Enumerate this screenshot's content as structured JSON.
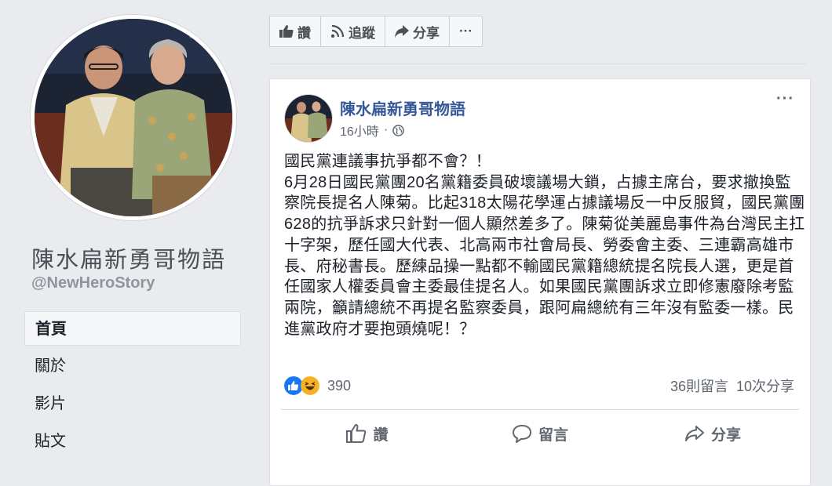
{
  "page": {
    "name": "陳水扁新勇哥物語",
    "handle": "@NewHeroStory"
  },
  "nav": {
    "items": [
      {
        "label": "首頁"
      },
      {
        "label": "關於"
      },
      {
        "label": "影片"
      },
      {
        "label": "貼文"
      }
    ]
  },
  "action_bar": {
    "like_label": "讚",
    "follow_label": "追蹤",
    "share_label": "分享",
    "more_label": "···"
  },
  "post": {
    "author": "陳水扁新勇哥物語",
    "time": "16小時",
    "separator": "·",
    "more_label": "···",
    "text": "國民黨連議事抗爭都不會？！\n6月28日國民黨團20名黨籍委員破壞議場大鎖，占據主席台，要求撤換監察院長提名人陳菊。比起318太陽花學運占據議場反一中反服貿，國民黨團628的抗爭訴求只針對一個人顯然差多了。陳菊從美麗島事件為台灣民主扛十字架，歷任國大代表、北高兩市社會局長、勞委會主委、三連霸高雄市長、府秘書長。歷練品操一點都不輸國民黨籍總統提名院長人選，更是首任國家人權委員會主委最佳提名人。如果國民黨團訴求立即修憲廢除考監兩院，籲請總統不再提名監察委員，跟阿扁總統有三年沒有監委一樣。民進黨政府才要抱頭燒呢！？",
    "reaction_count": "390",
    "comments": "36則留言",
    "shares": "10次分享",
    "actions": {
      "like": "讚",
      "comment": "留言",
      "share": "分享"
    }
  },
  "colors": {
    "link": "#365899",
    "secondary_text": "#606770",
    "background": "#e9ebee",
    "like_blue": "#1877f2",
    "haha_yellow": "#f7b125"
  }
}
